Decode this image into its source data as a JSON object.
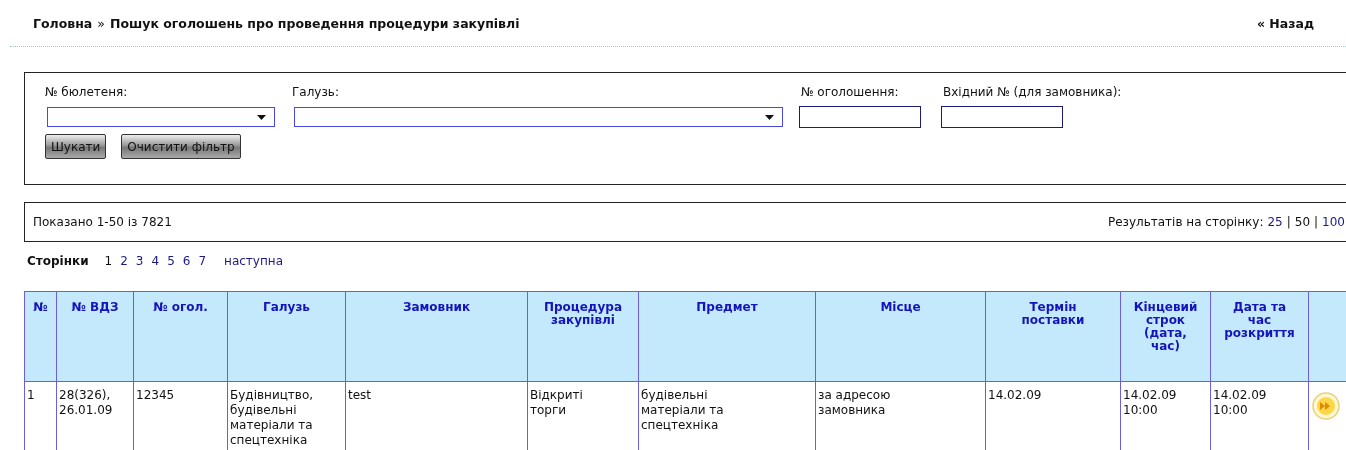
{
  "breadcrumb": {
    "home": "Головна",
    "separator": "»",
    "current": "Пошук оголошень про проведення процедури закупівлі"
  },
  "back_link": "« Назад",
  "filters": {
    "fields": [
      {
        "kind": "select",
        "label": "№ бюлетеня:"
      },
      {
        "kind": "select",
        "label": "Галузь:"
      },
      {
        "kind": "text",
        "label": "№ оголошення:"
      },
      {
        "kind": "text",
        "label": "Вхідний № (для замовника):"
      }
    ],
    "buttons": [
      "Шукати",
      "Очистити фільтр"
    ]
  },
  "summary": {
    "shown": "Показано 1-50 із 7821",
    "per_page_label": "Результатів на сторінку:",
    "separator": "|",
    "per_page_options": [
      {
        "label": "25",
        "selected": false
      },
      {
        "label": "50",
        "selected": true
      },
      {
        "label": "100",
        "selected": false
      }
    ]
  },
  "pagination": {
    "label": "Сторінки",
    "pages": [
      {
        "label": "1",
        "selected": true
      },
      {
        "label": "2",
        "selected": false
      },
      {
        "label": "3",
        "selected": false
      },
      {
        "label": "4",
        "selected": false
      },
      {
        "label": "5",
        "selected": false
      },
      {
        "label": "6",
        "selected": false
      },
      {
        "label": "7",
        "selected": false
      }
    ],
    "next": "наступна"
  },
  "table": {
    "columns": [
      "№",
      "№ ВДЗ",
      "№ огол.",
      "Галузь",
      "Замовник",
      "Процедура закупівлі",
      "Предмет",
      "Місце",
      "Термін поставки",
      "Кінцевий строк (дата, час)",
      "Дата та час розкриття"
    ],
    "rows": [
      {
        "cells": [
          "1",
          "28(326), 26.01.09",
          "12345",
          "Будівництво, будівельні матеріали та спецтехніка",
          "test",
          "Відкриті торги",
          "будівельні матеріали та спецтехніка",
          "за адресою замовника",
          "14.02.09",
          "14.02.09 10:00",
          "14.02.09 10:00"
        ]
      }
    ]
  }
}
